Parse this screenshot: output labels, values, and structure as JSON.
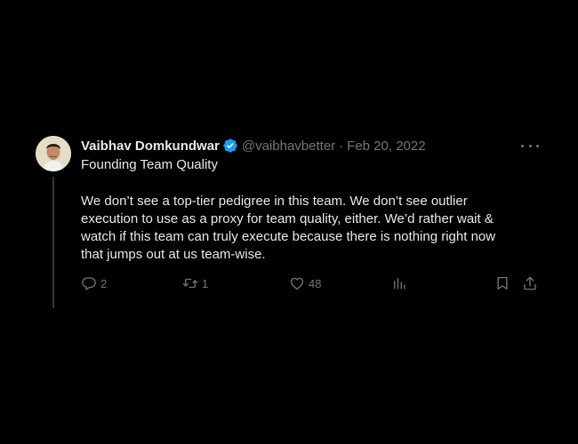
{
  "tweet": {
    "author_name": "Vaibhav Domkundwar",
    "handle": "@vaibhavbetter",
    "separator": "·",
    "date": "Feb 20, 2022",
    "subtitle": "Founding Team Quality",
    "body_lines": [
      "We don’t see a top-tier pedigree in this team. We don’t see outlier",
      "execution to use as a proxy for team quality, either. We’d rather wait &",
      "watch if this team can truly execute because there is nothing right now",
      "that jumps out at us team-wise."
    ],
    "replies": "2",
    "retweets": "1",
    "likes": "48",
    "icons": {
      "verified": "verified-badge-icon",
      "more": "more-icon",
      "reply": "reply-icon",
      "retweet": "retweet-icon",
      "like": "heart-icon",
      "views": "analytics-icon",
      "bookmark": "bookmark-icon",
      "share": "share-icon"
    },
    "colors": {
      "background": "#000000",
      "text": "#e7e9ea",
      "secondary": "#71767b",
      "verified": "#1d9bf0",
      "thread_line": "#333639"
    }
  }
}
